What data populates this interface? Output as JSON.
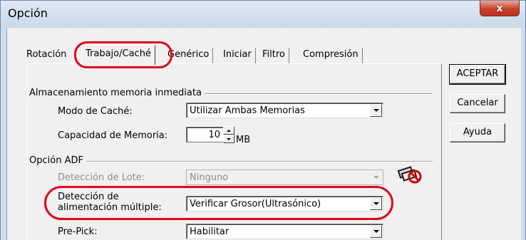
{
  "window": {
    "title": "Opción",
    "close_label": "x"
  },
  "tabs": [
    {
      "label": "Rotación"
    },
    {
      "label": "Trabajo/Caché"
    },
    {
      "label": "Genérico"
    },
    {
      "label": "Iniciar"
    },
    {
      "label": "Filtro"
    },
    {
      "label": "Compresión"
    }
  ],
  "active_tab": "Trabajo/Caché",
  "cache_group": {
    "title": "Almacenamiento memoria inmediata",
    "cache_mode_label": "Modo de Caché:",
    "cache_mode_value": "Utilizar Ambas Memorias",
    "memory_capacity_label": "Capacidad de Memoria:",
    "memory_capacity_value": "10",
    "memory_capacity_unit": "MB"
  },
  "adf_group": {
    "title": "Opción ADF",
    "batch_detection_label": "Detección de Lote:",
    "batch_detection_value": "Ninguno",
    "multifeed_label_line1": "Detección de",
    "multifeed_label_line2": "alimentación múltiple:",
    "multifeed_value": "Verificar Grosor(Ultrasónico)",
    "prepick_label": "Pre-Pick:",
    "prepick_value": "Habilitar"
  },
  "buttons": {
    "ok": "ACEPTAR",
    "cancel": "Cancelar",
    "help": "Ayuda"
  },
  "icons": {
    "close": "close-icon",
    "adf_disabled": "adf-no-icon"
  },
  "colors": {
    "highlight": "#e3001b",
    "title_bar": "#cfdcec",
    "close_button": "#c7402b"
  }
}
